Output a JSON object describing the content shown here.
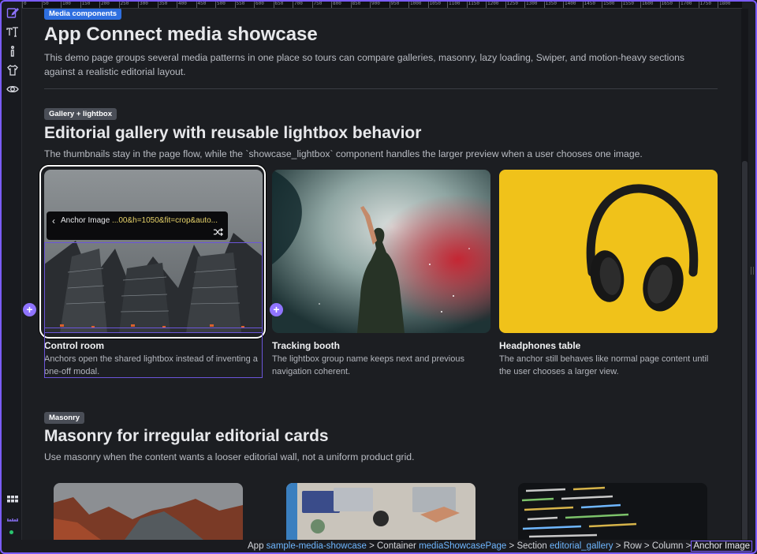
{
  "ruler": {
    "ticks": [
      "0",
      "50",
      "100",
      "150",
      "200",
      "250",
      "300",
      "350",
      "400",
      "450",
      "500",
      "550",
      "600",
      "650",
      "700",
      "750",
      "800",
      "850",
      "900",
      "950",
      "1000",
      "1050",
      "1100",
      "1150",
      "1200",
      "1250",
      "1300",
      "1350",
      "1400",
      "1450",
      "1500",
      "1550",
      "1600",
      "1650",
      "1700",
      "1750",
      "1800"
    ]
  },
  "toolbar": {
    "icons": [
      "edit-icon",
      "text-tool-icon",
      "info-icon",
      "shirt-icon",
      "eye-icon",
      "grid-icon",
      "ruler-icon"
    ]
  },
  "page": {
    "section_badge": "Media components",
    "title": "App Connect media showcase",
    "lead": "This demo page groups several media patterns in one place so tours can compare galleries, masonry, lazy loading, Swiper, and motion-heavy sections against a realistic editorial layout."
  },
  "gallery": {
    "badge": "Gallery + lightbox",
    "title": "Editorial gallery with reusable lightbox behavior",
    "lead": "The thumbnails stay in the page flow, while the `showcase_lightbox` component handles the larger preview when a user chooses one image.",
    "cards": [
      {
        "title": "Control room",
        "text": "Anchors open the shared lightbox instead of inventing a one-off modal."
      },
      {
        "title": "Tracking booth",
        "text": "The lightbox group name keeps next and previous navigation coherent."
      },
      {
        "title": "Headphones table",
        "text": "The anchor still behaves like normal page content until the user chooses a larger view."
      }
    ]
  },
  "popover": {
    "label": "Anchor Image",
    "value": "...00&h=1050&fit=crop&auto..."
  },
  "masonry": {
    "badge": "Masonry",
    "title": "Masonry for irregular editorial cards",
    "lead": "Use masonry when the content wants a looser editorial wall, not a uniform product grid."
  },
  "breadcrumb": {
    "app_label": "App",
    "app_value": "sample-media-showcase",
    "container_label": "Container",
    "container_value": "mediaShowcasePage",
    "section_label": "Section",
    "section_value": "editorial_gallery",
    "row_label": "Row",
    "column_label": "Column",
    "current": "Anchor Image",
    "separator": ">"
  },
  "colors": {
    "accent": "#7b5cff",
    "link": "#6fb7ff",
    "background": "#1c1e22"
  }
}
